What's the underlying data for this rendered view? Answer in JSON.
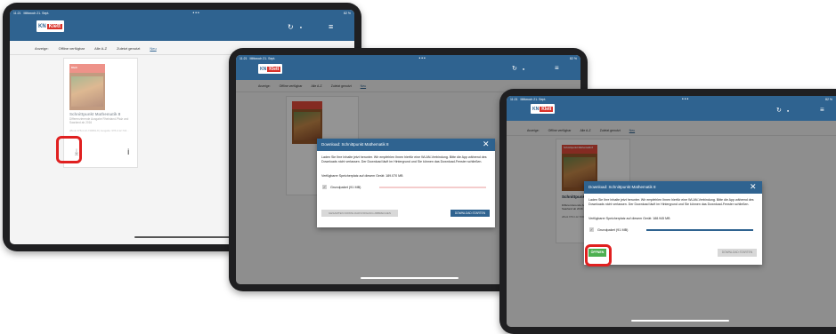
{
  "status": {
    "time": "11:21",
    "date": "Mittwoch 21. Sept.",
    "battery": "82 %",
    "dots": "•••"
  },
  "app": {
    "logo_mark": "KN",
    "logo_brand": "Klett",
    "sync_icon": "↻",
    "account_icon": "●",
    "menu_icon": "≡"
  },
  "tabs": [
    {
      "label": "Anzeige:"
    },
    {
      "label": "Offline verfügbar"
    },
    {
      "label": "Alle A-Z"
    },
    {
      "label": "Zuletzt genutzt"
    },
    {
      "label": "Neu"
    }
  ],
  "book": {
    "cover_label": "Klett",
    "cover_title": "Schnittpunkt Mathematik 8",
    "title": "Schnittpunkt Mathematik 8",
    "subtitle": "Differenzierende Ausgabe Rheinland-Pfalz und Saarland ab 2016",
    "code": "eBook 978-3-12-740081-8 | Ausgabe: 978-3-12-744...",
    "download_icon": "⤓",
    "info_icon": "i"
  },
  "dialog": {
    "title": "Download: Schnittpunkt Mathematik 8",
    "close_icon": "✕",
    "body": "Laden Sie Ihre Inhalte jetzt herunter. Wir empfehlen Ihnen hierfür eine WLAN-Verbindung. Bitte die App während des Downloads nicht verlassen. Der Download läuft im Hintergrund und Sie können das Download-Fenster schließen.",
    "storage_first": "Verfügbarer Speicherplatz auf diesem Gerät: 189.070 MB",
    "storage_second": "Verfügbarer Speicherplatz auf diesem Gerät: 188.945 MB",
    "checkbox_icon": "✓",
    "package_label": "Grundpaket (91 MB)",
    "cancel_label": "GESAMTEN DOWNLOADVORGANG ABBRECHEN",
    "start_label": "DOWNLOAD STARTEN",
    "open_label": "ÖFFNEN",
    "progress_first": 0.0,
    "progress_second": 1.0
  },
  "colors": {
    "primary": "#2f6390",
    "brand_red": "#d9322a",
    "highlight": "#e02020",
    "open_green": "#4caf50"
  }
}
